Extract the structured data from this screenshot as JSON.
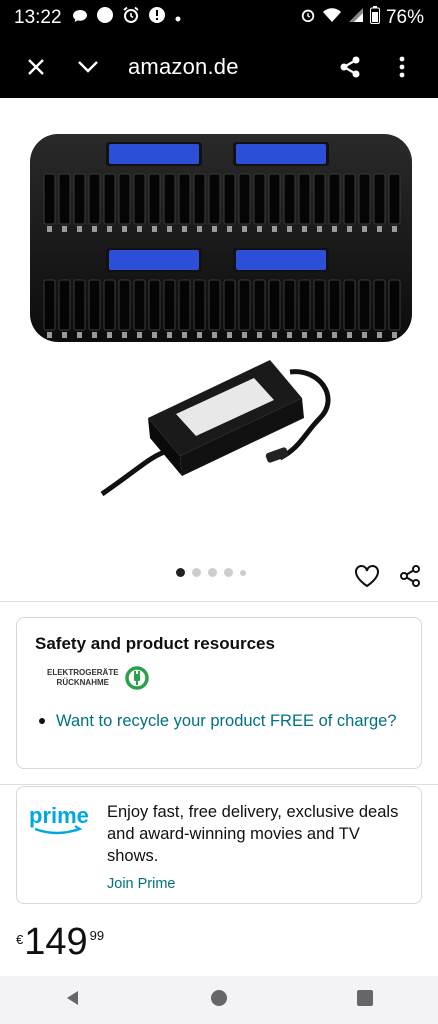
{
  "status": {
    "time": "13:22",
    "battery": "76%"
  },
  "topbar": {
    "url": "amazon.de"
  },
  "gallery": {
    "total_dots": 5,
    "active_index": 0
  },
  "safety": {
    "title": "Safety and product resources",
    "badge_line1": "ELEKTROGERÄTE",
    "badge_line2": "RÜCKNAHME",
    "recycle_link": "Want to recycle your product FREE of charge?"
  },
  "prime": {
    "logo_text": "prime",
    "description": "Enjoy fast, free delivery, exclusive deals and award-winning movies and TV shows.",
    "join_link": "Join Prime"
  },
  "price": {
    "currency": "€",
    "whole": "149",
    "fraction": "99"
  },
  "colors": {
    "link": "#007185",
    "prime_blue": "#00a8e1",
    "lcd_blue": "#2b4fd6",
    "recycle_green": "#2aa04a"
  }
}
